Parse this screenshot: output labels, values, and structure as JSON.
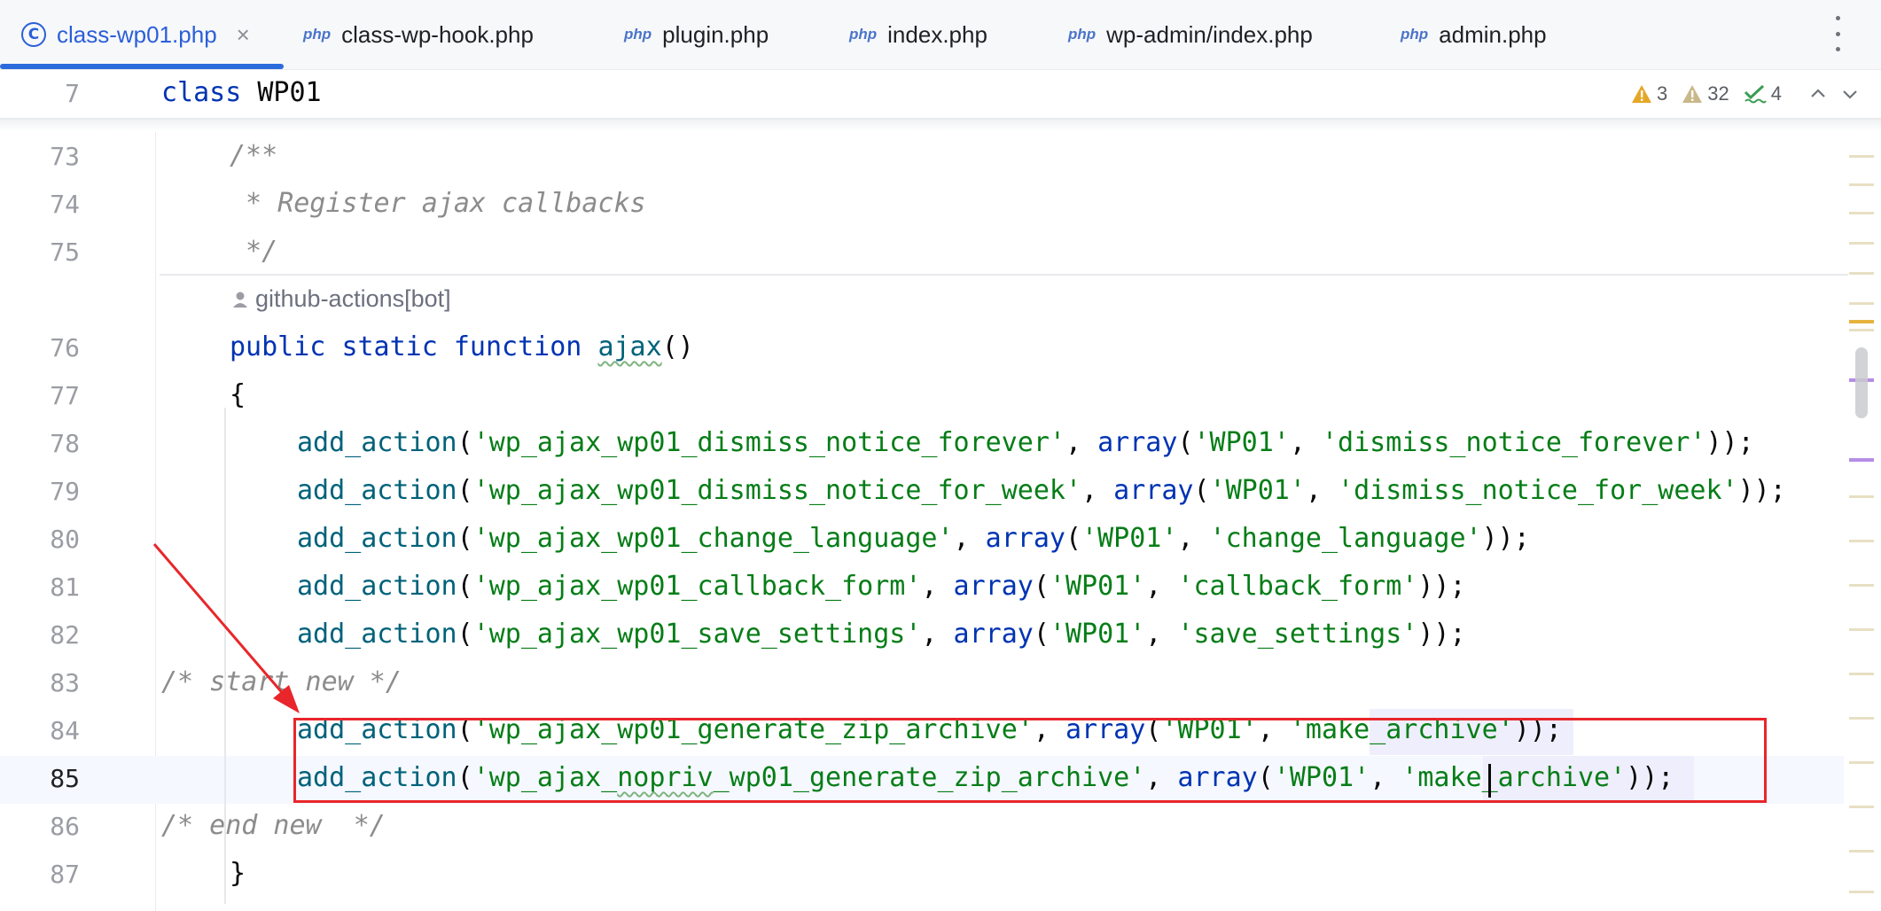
{
  "tabs": [
    {
      "label": "class-wp01.php",
      "active": true,
      "icon": "class-icon",
      "closable": true
    },
    {
      "label": "class-wp-hook.php",
      "active": false,
      "icon": "php-file-icon"
    },
    {
      "label": "plugin.php",
      "active": false,
      "icon": "php-file-icon"
    },
    {
      "label": "index.php",
      "active": false,
      "icon": "php-file-icon"
    },
    {
      "label": "wp-admin/index.php",
      "active": false,
      "icon": "php-file-icon"
    },
    {
      "label": "admin.php",
      "active": false,
      "icon": "php-file-icon"
    }
  ],
  "tab_icons": {
    "class_glyph": "C",
    "php_glyph": "php",
    "close_glyph": "×"
  },
  "sticky": {
    "line": "7",
    "code": {
      "kw": "class",
      "name": " WP01"
    }
  },
  "inspections": {
    "warnings_a": "3",
    "warnings_b": "32",
    "ok": "4"
  },
  "author": "github-actions[bot]",
  "lines": {
    "n73": "73",
    "n74": "74",
    "n75": "75",
    "n76": "76",
    "n77": "77",
    "n78": "78",
    "n79": "79",
    "n80": "80",
    "n81": "81",
    "n82": "82",
    "n83": "83",
    "n84": "84",
    "n85": "85",
    "n86": "86",
    "n87": "87"
  },
  "code": {
    "l73": "/**",
    "l74": " * Register ajax callbacks",
    "l75": " */",
    "l76": {
      "kw1": "public",
      "kw2": "static",
      "kw3": "function",
      "fn": "ajax",
      "rest": "()"
    },
    "l77": "{",
    "l78": {
      "fn": "add_action",
      "s1": "'wp_ajax_wp01_dismiss_notice_forever'",
      "s2": "'WP01'",
      "s3": "'dismiss_notice_forever'"
    },
    "l79": {
      "fn": "add_action",
      "s1": "'wp_ajax_wp01_dismiss_notice_for_week'",
      "s2": "'WP01'",
      "s3": "'dismiss_notice_for_week'"
    },
    "l80": {
      "fn": "add_action",
      "s1": "'wp_ajax_wp01_change_language'",
      "s2": "'WP01'",
      "s3": "'change_language'"
    },
    "l81": {
      "fn": "add_action",
      "s1": "'wp_ajax_wp01_callback_form'",
      "s2": "'WP01'",
      "s3": "'callback_form'"
    },
    "l82": {
      "fn": "add_action",
      "s1": "'wp_ajax_wp01_save_settings'",
      "s2": "'WP01'",
      "s3": "'save_settings'"
    },
    "l83": "/* start new */",
    "l84": {
      "fn": "add_action",
      "s1": "'wp_ajax_wp01_generate_zip_archive'",
      "s2": "'WP01'",
      "s3": "'make_archive'"
    },
    "l85": {
      "fn": "add_action",
      "s1a": "'wp_ajax_",
      "s1b": "nopriv",
      "s1c": "_wp01_generate_zip_archive'",
      "s2": "'WP01'",
      "s3a": "'",
      "s3b": "make_archive'"
    },
    "l86": "/* end new  */",
    "l87": "}"
  },
  "syntax": {
    "open": "(",
    "comma": ", ",
    "array": "array",
    "close": "));",
    "close_cut": "));"
  },
  "colors": {
    "keyword": "#0033b3",
    "function": "#00627a",
    "string": "#067d17",
    "comment": "#8c8c8c",
    "annotation": "#e8262b"
  }
}
